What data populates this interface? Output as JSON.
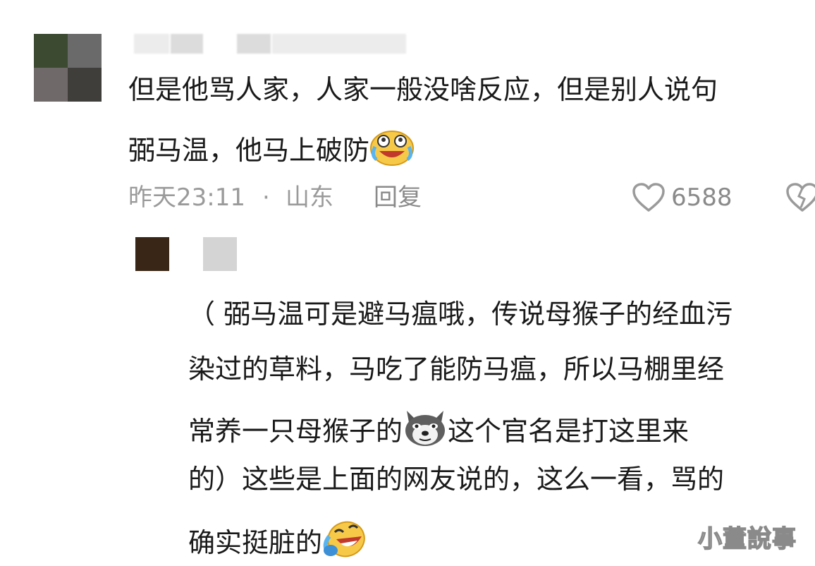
{
  "comment": {
    "lines": [
      "但是他骂人家，人家一般没啥反应，但是别人说句",
      "弼马温，他马上破防"
    ],
    "time": "昨天23:11",
    "dot": "·",
    "location": "山东",
    "reply_label": "回复",
    "like_count": "6588"
  },
  "reply": {
    "lines": [
      "（ 弼马温可是避马瘟哦，传说母猴子的经血污",
      "染过的草料，马吃了能防马瘟，所以马棚里经",
      "常养一只母猴子的",
      "这个官名是打这里来",
      "的）这些是上面的网友说的，这么一看，骂的",
      "确实挺脏的"
    ]
  },
  "watermark": "小董說事",
  "icons": {
    "emoji_1": "crying-laughing-emoji",
    "emoji_2": "husky-dog-emoji",
    "emoji_3": "rofl-emoji",
    "like": "heart-icon",
    "dislike": "broken-heart-icon"
  }
}
